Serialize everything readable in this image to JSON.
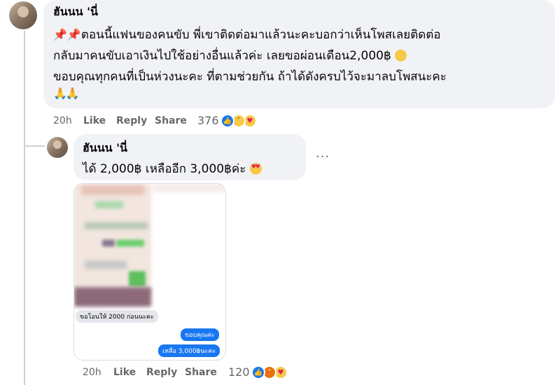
{
  "comment": {
    "author": "ฮันนน 'นี่",
    "lines": [
      "ตอนนี้แฟนของคนขับ พี่เขาติดต่อมาแล้วนะคะบอกว่าเห็นโพสเลยติดต่อ",
      "กลับมาคนขับเอาเงินไปใช้อย่างอื่นแล้วค่ะ เลยขอผ่อนเดือน2,000฿",
      "ขอบคุณทุกคนที่เป็นห่วงนะคะ ที่ตามช่วยกัน ถ้าได้ดังครบไว้จะมาลบโพสนะคะ"
    ],
    "pin_emoji": "📌📌",
    "sad_emoji": "😥",
    "pray_emoji": "🙏🙏",
    "time": "20h",
    "like": "Like",
    "reply": "Reply",
    "share": "Share",
    "reaction_count": "376",
    "reactions": [
      "like-icon",
      "sad-icon",
      "care-icon"
    ]
  },
  "reply": {
    "author": "ฮันนน 'นี่",
    "text": "ได้ 2,000฿ เหลืออีก 3,000฿ค่ะ",
    "emoji": "😍",
    "more": "···",
    "attachment": {
      "chat_left": "ขอโอนให้ 2000 ก่อนนะคะ",
      "chat_right_1": "ขอบคุณค่ะ",
      "chat_right_2": "เหลือ 3,000฿นะคะ"
    },
    "time": "20h",
    "like": "Like",
    "reply": "Reply",
    "share": "Share",
    "reaction_count": "120",
    "reactions": [
      "like-icon",
      "angry-icon",
      "care-icon"
    ]
  }
}
